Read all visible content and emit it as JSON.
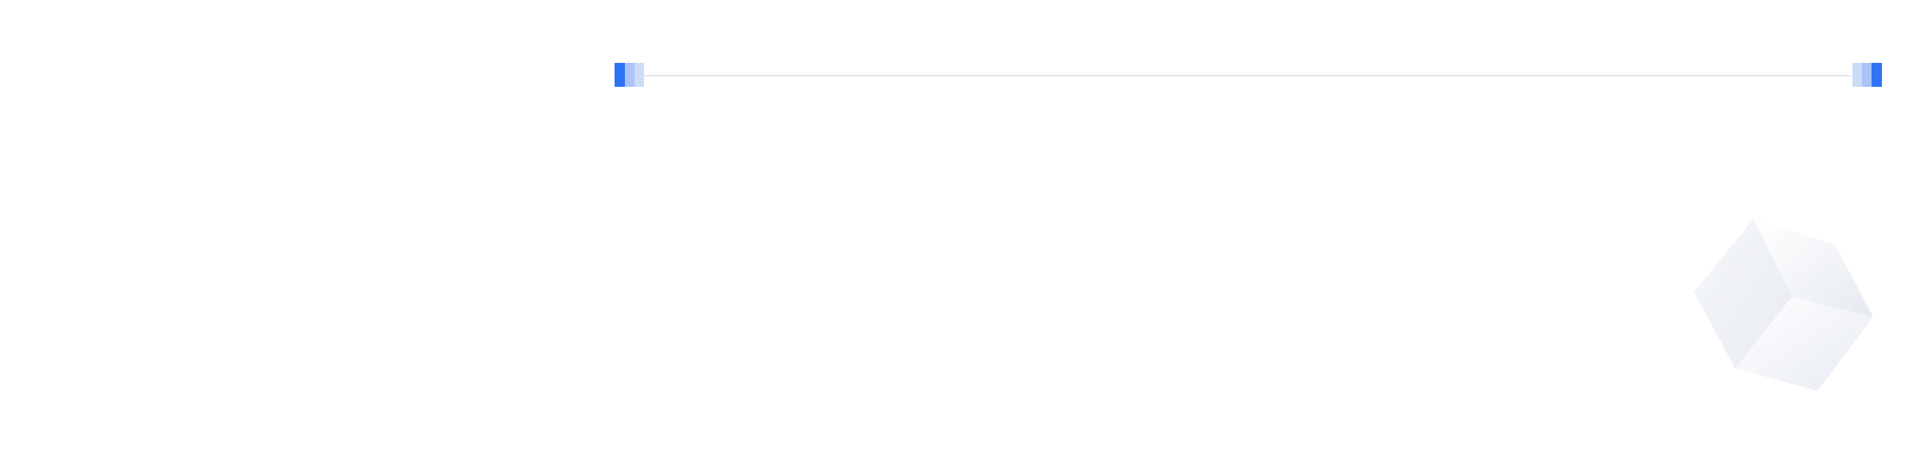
{
  "colors": {
    "accent": "#2f73f6",
    "accent_mid": "#a9c4f7",
    "accent_light": "#ccdcf8",
    "divider": "#e3e6ec",
    "cube_light": "#ffffff",
    "cube_shade": "#e9ecf2"
  },
  "icons": {
    "left_bracket": "bracket-marker-icon",
    "right_bracket": "bracket-marker-icon",
    "cube": "cube-icon"
  }
}
